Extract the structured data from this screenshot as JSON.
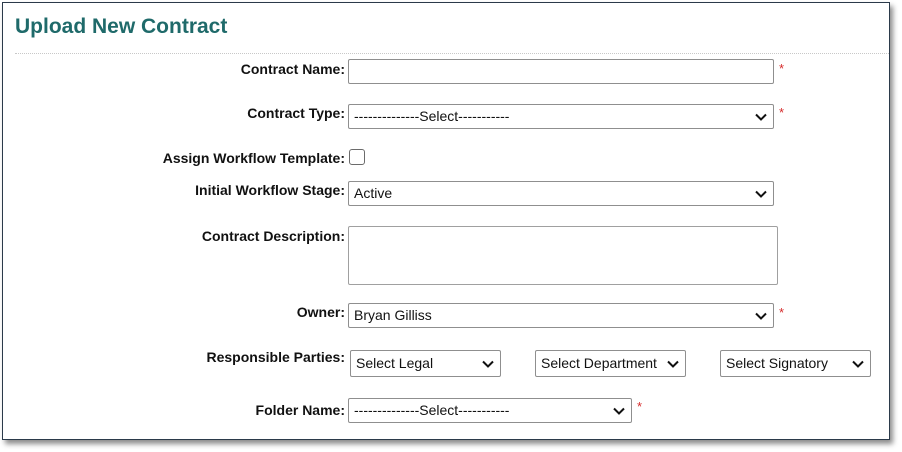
{
  "page": {
    "title": "Upload New Contract"
  },
  "form": {
    "contract_name": {
      "label": "Contract Name:",
      "value": "",
      "required": "*"
    },
    "contract_type": {
      "label": "Contract Type:",
      "selected": "--------------Select-----------",
      "required": "*"
    },
    "assign_workflow_template": {
      "label": "Assign Workflow Template:",
      "checked": false
    },
    "initial_workflow_stage": {
      "label": "Initial Workflow Stage:",
      "selected": "Active"
    },
    "contract_description": {
      "label": "Contract Description:",
      "value": ""
    },
    "owner": {
      "label": "Owner:",
      "selected": "Bryan Gilliss",
      "required": "*"
    },
    "responsible_parties": {
      "label": "Responsible Parties:",
      "legal": "Select Legal",
      "department": "Select Department",
      "signatory": "Select Signatory"
    },
    "folder_name": {
      "label": "Folder Name:",
      "selected": "--------------Select-----------",
      "required": "*"
    }
  },
  "icons": {
    "dropdown": "chevron-down-icon"
  },
  "colors": {
    "title": "#1f6a6a",
    "required": "#d62b2b"
  }
}
